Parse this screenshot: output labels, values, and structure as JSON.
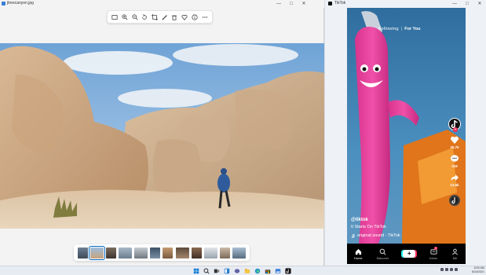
{
  "photos_window": {
    "title": "jtreecanyon.jpg",
    "window_controls": [
      "—",
      "□",
      "✕"
    ],
    "toolbar_icons": [
      "gallery-icon",
      "zoom-in-icon",
      "zoom-out-icon",
      "rotate-icon",
      "crop-icon",
      "edit-icon",
      "delete-icon",
      "favorite-icon",
      "info-icon",
      "more-icon"
    ],
    "filmstrip_count": 12,
    "filmstrip_selected_index": 1
  },
  "tiktok_window": {
    "title": "TikTok",
    "window_controls": [
      "—",
      "□",
      "✕"
    ],
    "feed_tabs": {
      "following": "Following",
      "for_you": "For You",
      "active": "For You"
    },
    "actions": {
      "likes": "35.7k",
      "comments": "319",
      "shares": "13.5k"
    },
    "caption": {
      "username": "@tiktok",
      "text": "It Starts On TikTok",
      "sound": "original sound - TikTok"
    },
    "bottom_nav": {
      "home": "Home",
      "discover": "Discover",
      "create": "+",
      "inbox": "Inbox",
      "inbox_badge": "9",
      "me": "Me"
    }
  },
  "taskbar": {
    "icons": [
      "start-icon",
      "search-icon",
      "task-view-icon",
      "widgets-icon",
      "chat-icon",
      "file-explorer-icon",
      "edge-icon",
      "store-icon",
      "photos-icon",
      "tiktok-icon"
    ],
    "time": "8:00 AM",
    "date": "6/24/2021"
  },
  "colors": {
    "tiktok_red": "#fe2c55",
    "tiktok_cyan": "#25f4ee",
    "accent": "#0067c0"
  }
}
